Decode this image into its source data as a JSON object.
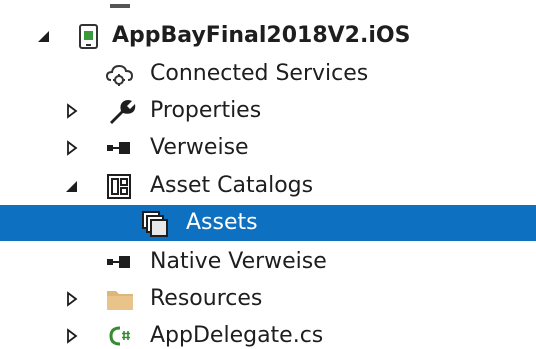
{
  "project": {
    "name": "AppBayFinal2018V2.iOS",
    "icon": "ios-project-icon",
    "expanded": true
  },
  "items": [
    {
      "label": "Connected Services",
      "icon": "cloud-gear-icon",
      "expander": "none"
    },
    {
      "label": "Properties",
      "icon": "wrench-icon",
      "expander": "collapsed"
    },
    {
      "label": "Verweise",
      "icon": "references-icon",
      "expander": "collapsed"
    },
    {
      "label": "Asset Catalogs",
      "icon": "asset-catalog-icon",
      "expander": "expanded"
    },
    {
      "label": "Assets",
      "icon": "assets-stack-icon",
      "expander": "none",
      "selected": true
    },
    {
      "label": "Native Verweise",
      "icon": "references-icon",
      "expander": "none"
    },
    {
      "label": "Resources",
      "icon": "folder-icon",
      "expander": "collapsed"
    },
    {
      "label": "AppDelegate.cs",
      "icon": "csharp-file-icon",
      "expander": "collapsed"
    }
  ],
  "colors": {
    "selection": "#0e70c0",
    "text": "#1e1e1e",
    "folder": "#dcb67a",
    "csharp": "#388a34",
    "project_icon": "#3c9a3c"
  }
}
